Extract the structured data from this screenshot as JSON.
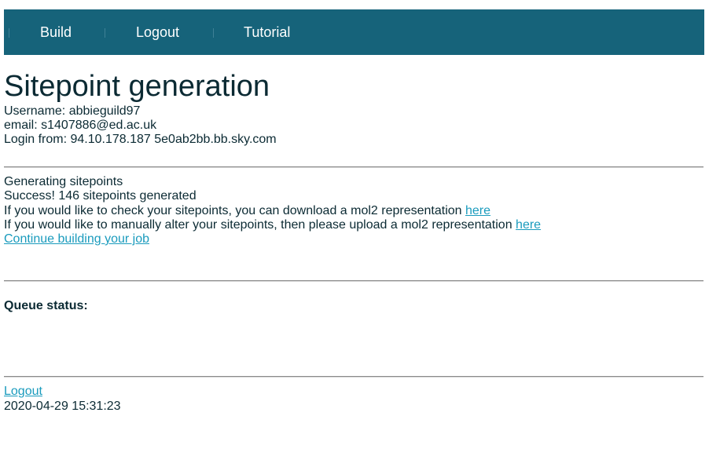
{
  "nav": {
    "items": [
      {
        "label": "Build"
      },
      {
        "label": "Logout"
      },
      {
        "label": "Tutorial"
      }
    ]
  },
  "page": {
    "title": "Sitepoint generation"
  },
  "user": {
    "username_line": "Username: abbieguild97",
    "email_line": "email: s1407886@ed.ac.uk",
    "login_line": "Login from: 94.10.178.187 5e0ab2bb.bb.sky.com"
  },
  "sitepoints": {
    "heading": "Generating sitepoints",
    "success": "Success! 146 sitepoints generated",
    "download_text": "If you would like to check your sitepoints, you can download a mol2 representation ",
    "download_link": "here",
    "upload_text": "If you would like to manually alter your sitepoints, then please upload a mol2 representation ",
    "upload_link": "here",
    "continue_link": "Continue building your job"
  },
  "queue": {
    "label": "Queue status:"
  },
  "footer": {
    "logout_link": "Logout",
    "timestamp": "2020-04-29 15:31:23"
  },
  "colors": {
    "nav_background": "#16637a",
    "link": "#1a9bbd",
    "text": "#0b2a33"
  }
}
